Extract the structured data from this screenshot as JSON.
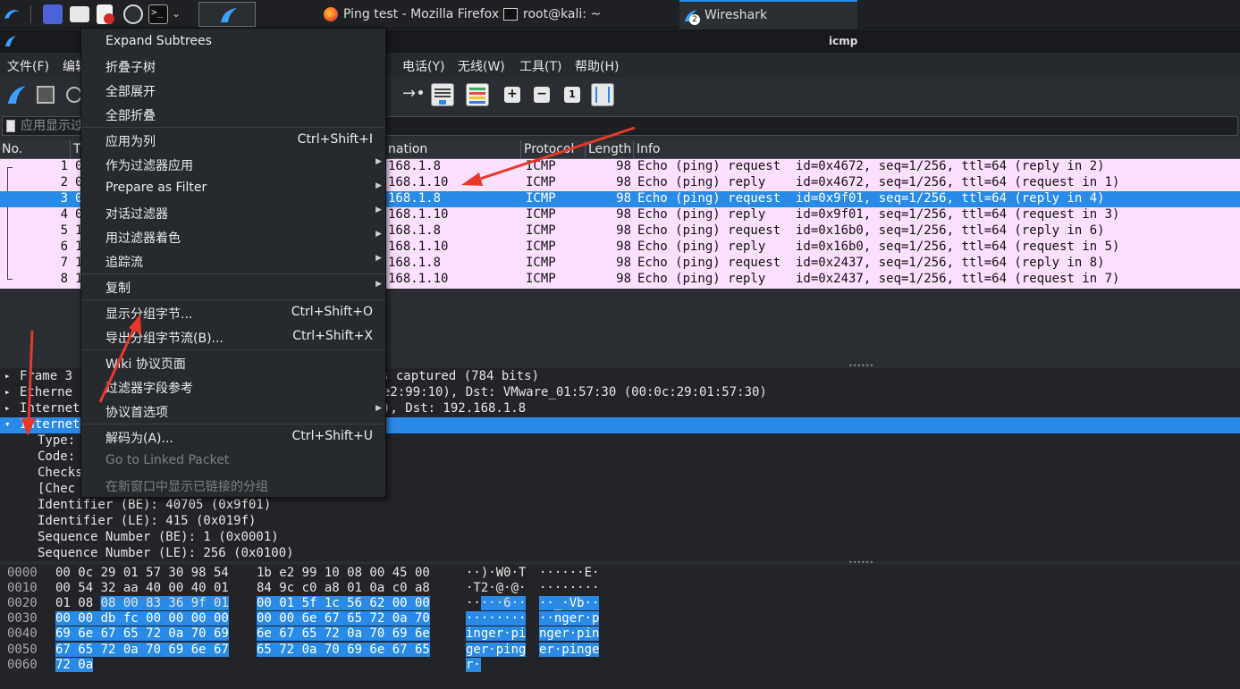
{
  "taskbar": {
    "tasks": [
      {
        "label": "Ping test - Mozilla Firefox",
        "icon": "firefox-icon"
      },
      {
        "label": "root@kali: ~",
        "icon": "terminal-icon"
      },
      {
        "label": "Wireshark",
        "icon": "wireshark-icon",
        "badge": "2"
      }
    ]
  },
  "window": {
    "title": "icmp"
  },
  "menubar": {
    "items": [
      "文件(F)",
      "编辑",
      "电话(Y)",
      "无线(W)",
      "工具(T)",
      "帮助(H)"
    ]
  },
  "filter": {
    "placeholder": "应用显示过"
  },
  "packet_list": {
    "columns": [
      "No.",
      "T",
      "nation",
      "Protocol",
      "Length",
      "Info"
    ],
    "rows": [
      {
        "no": "1",
        "t": "0",
        "dst": "168.1.8",
        "proto": "ICMP",
        "len": "98",
        "info": "Echo (ping) request  id=0x4672, seq=1/256, ttl=64 (reply in 2)"
      },
      {
        "no": "2",
        "t": "0",
        "dst": "168.1.10",
        "proto": "ICMP",
        "len": "98",
        "info": "Echo (ping) reply    id=0x4672, seq=1/256, ttl=64 (request in 1)"
      },
      {
        "no": "3",
        "t": "0",
        "dst": "168.1.8",
        "proto": "ICMP",
        "len": "98",
        "info": "Echo (ping) request  id=0x9f01, seq=1/256, ttl=64 (reply in 4)"
      },
      {
        "no": "4",
        "t": "0",
        "dst": "168.1.10",
        "proto": "ICMP",
        "len": "98",
        "info": "Echo (ping) reply    id=0x9f01, seq=1/256, ttl=64 (request in 3)"
      },
      {
        "no": "5",
        "t": "1",
        "dst": "168.1.8",
        "proto": "ICMP",
        "len": "98",
        "info": "Echo (ping) request  id=0x16b0, seq=1/256, ttl=64 (reply in 6)"
      },
      {
        "no": "6",
        "t": "1",
        "dst": "168.1.10",
        "proto": "ICMP",
        "len": "98",
        "info": "Echo (ping) reply    id=0x16b0, seq=1/256, ttl=64 (request in 5)"
      },
      {
        "no": "7",
        "t": "1",
        "dst": "168.1.8",
        "proto": "ICMP",
        "len": "98",
        "info": "Echo (ping) request  id=0x2437, seq=1/256, ttl=64 (reply in 8)"
      },
      {
        "no": "8",
        "t": "1",
        "dst": "168.1.10",
        "proto": "ICMP",
        "len": "98",
        "info": "Echo (ping) reply    id=0x2437, seq=1/256, ttl=64 (request in 7)"
      }
    ],
    "selected_row": "3"
  },
  "details": {
    "rows": [
      {
        "left": "Frame 3",
        "right": "s captured (784 bits)"
      },
      {
        "left": "Etherne",
        "right": "e2:99:10), Dst: VMware_01:57:30 (00:0c:29:01:57:30)"
      },
      {
        "left": "Internet",
        "right": "), Dst: 192.168.1.8"
      },
      {
        "left": "Internet",
        "right": ""
      },
      {
        "left": "Type:",
        "right": ""
      },
      {
        "left": "Code:",
        "right": ""
      },
      {
        "left": "Checks",
        "right": ""
      },
      {
        "left": "[Chec",
        "right": ""
      },
      {
        "left": "Identifier (BE): 40705 (0x9f01)",
        "right": ""
      },
      {
        "left": "Identifier (LE): 415 (0x019f)",
        "right": ""
      },
      {
        "left": "Sequence Number (BE): 1 (0x0001)",
        "right": ""
      },
      {
        "left": "Sequence Number (LE): 256 (0x0100)",
        "right": ""
      }
    ]
  },
  "bytes": {
    "rows": [
      {
        "off": "0000",
        "hex_a": "00 0c 29 01 57 30 98 54",
        "hex_b": "1b e2 99 10 08 00 45 00",
        "ascii_a": "··)·W0·T",
        "ascii_b": "······E·"
      },
      {
        "off": "0010",
        "hex_a": "00 54 32 aa 40 00 40 01",
        "hex_b": "84 9c c0 a8 01 0a c0 a8",
        "ascii_a": "·T2·@·@·",
        "ascii_b": "········"
      },
      {
        "off": "0020",
        "hex_a": "01 08 08 00 83 36 9f 01",
        "hex_b": "00 01 5f 1c 56 62 00 00",
        "ascii_a": "·····6··",
        "ascii_b": "··_·Vb··"
      },
      {
        "off": "0030",
        "hex_a": "00 00 db fc 00 00 00 00",
        "hex_b": "00 00 6e 67 65 72 0a 70",
        "ascii_a": "········",
        "ascii_b": "··nger·p"
      },
      {
        "off": "0040",
        "hex_a": "69 6e 67 65 72 0a 70 69",
        "hex_b": "6e 67 65 72 0a 70 69 6e",
        "ascii_a": "inger·pi",
        "ascii_b": "nger·pin"
      },
      {
        "off": "0050",
        "hex_a": "67 65 72 0a 70 69 6e 67",
        "hex_b": "65 72 0a 70 69 6e 67 65",
        "ascii_a": "ger·ping",
        "ascii_b": "er·pinge"
      },
      {
        "off": "0060",
        "hex_a": "72 0a",
        "hex_b": "",
        "ascii_a": "r·",
        "ascii_b": ""
      }
    ]
  },
  "context_menu": {
    "items": [
      {
        "label": "Expand Subtrees",
        "shortcut": "",
        "submenu": false,
        "disabled": false
      },
      {
        "label": "折叠子树",
        "shortcut": "",
        "submenu": false,
        "disabled": false
      },
      {
        "label": "全部展开",
        "shortcut": "",
        "submenu": false,
        "disabled": false
      },
      {
        "label": "全部折叠",
        "shortcut": "",
        "submenu": false,
        "disabled": false
      },
      {
        "label": "应用为列",
        "shortcut": "Ctrl+Shift+I",
        "submenu": false,
        "disabled": false
      },
      {
        "label": "作为过滤器应用",
        "shortcut": "",
        "submenu": true,
        "disabled": false
      },
      {
        "label": "Prepare as Filter",
        "shortcut": "",
        "submenu": true,
        "disabled": false
      },
      {
        "label": "对话过滤器",
        "shortcut": "",
        "submenu": true,
        "disabled": false
      },
      {
        "label": "用过滤器着色",
        "shortcut": "",
        "submenu": true,
        "disabled": false
      },
      {
        "label": "追踪流",
        "shortcut": "",
        "submenu": true,
        "disabled": false
      },
      {
        "label": "复制",
        "shortcut": "",
        "submenu": true,
        "disabled": false
      },
      {
        "label": "显示分组字节...",
        "shortcut": "Ctrl+Shift+O",
        "submenu": false,
        "disabled": false
      },
      {
        "label": "导出分组字节流(B)...",
        "shortcut": "Ctrl+Shift+X",
        "submenu": false,
        "disabled": false
      },
      {
        "label": "Wiki 协议页面",
        "shortcut": "",
        "submenu": false,
        "disabled": false
      },
      {
        "label": "过滤器字段参考",
        "shortcut": "",
        "submenu": false,
        "disabled": false
      },
      {
        "label": "协议首选项",
        "shortcut": "",
        "submenu": true,
        "disabled": false
      },
      {
        "label": "解码为(A)...",
        "shortcut": "Ctrl+Shift+U",
        "submenu": false,
        "disabled": false
      },
      {
        "label": "Go to Linked Packet",
        "shortcut": "",
        "submenu": false,
        "disabled": true
      },
      {
        "label": "在新窗口中显示已链接的分组",
        "shortcut": "",
        "submenu": false,
        "disabled": true
      }
    ]
  },
  "colors": {
    "accent": "#2a8ae8",
    "packet_bg": "#fce0ff",
    "annotation_red": "#e8382a"
  }
}
